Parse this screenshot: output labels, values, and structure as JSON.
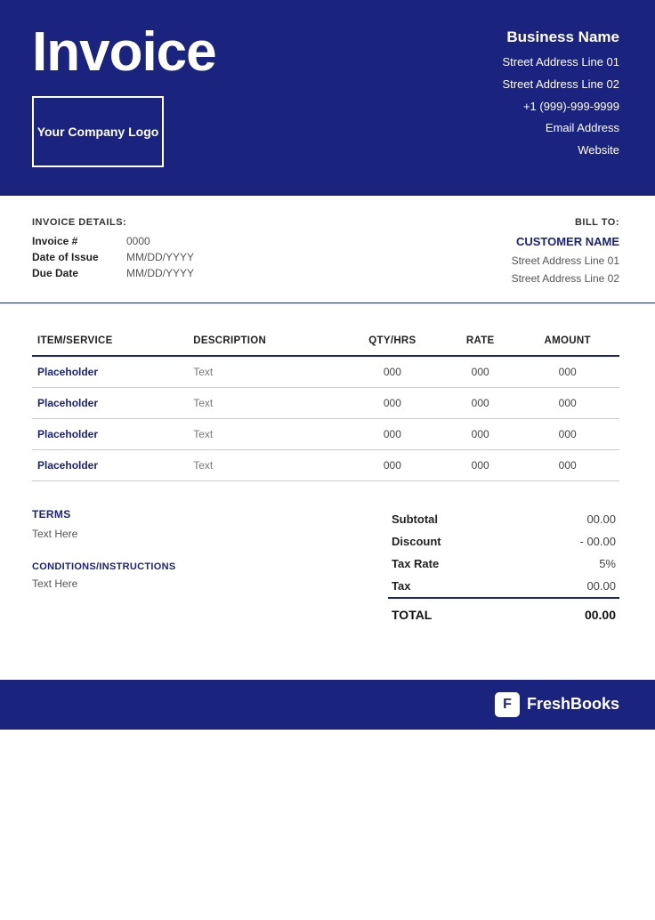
{
  "header": {
    "title": "Invoice",
    "logo_text": "Your Company Logo",
    "business": {
      "name": "Business Name",
      "address1": "Street Address Line 01",
      "address2": "Street Address Line 02",
      "phone": "+1 (999)-999-9999",
      "email": "Email Address",
      "website": "Website"
    }
  },
  "invoice_details": {
    "label": "INVOICE DETAILS:",
    "fields": [
      {
        "key": "Invoice #",
        "value": "0000"
      },
      {
        "key": "Date of Issue",
        "value": "MM/DD/YYYY"
      },
      {
        "key": "Due Date",
        "value": "MM/DD/YYYY"
      }
    ],
    "bill_to": {
      "label": "BILL TO:",
      "customer_name": "CUSTOMER NAME",
      "address1": "Street Address Line 01",
      "address2": "Street Address Line 02"
    }
  },
  "table": {
    "headers": [
      "ITEM/SERVICE",
      "DESCRIPTION",
      "QTY/HRS",
      "RATE",
      "AMOUNT"
    ],
    "rows": [
      {
        "name": "Placeholder",
        "description": "Text",
        "qty": "000",
        "rate": "000",
        "amount": "000"
      },
      {
        "name": "Placeholder",
        "description": "Text",
        "qty": "000",
        "rate": "000",
        "amount": "000"
      },
      {
        "name": "Placeholder",
        "description": "Text",
        "qty": "000",
        "rate": "000",
        "amount": "000"
      },
      {
        "name": "Placeholder",
        "description": "Text",
        "qty": "000",
        "rate": "000",
        "amount": "000"
      }
    ]
  },
  "terms": {
    "label": "TERMS",
    "text": "Text Here",
    "conditions_label": "CONDITIONS/INSTRUCTIONS",
    "conditions_text": "Text Here"
  },
  "totals": {
    "subtotal_label": "Subtotal",
    "subtotal_value": "00.00",
    "discount_label": "Discount",
    "discount_value": "- 00.00",
    "taxrate_label": "Tax Rate",
    "taxrate_value": "5%",
    "tax_label": "Tax",
    "tax_value": "00.00",
    "total_label": "TOTAL",
    "total_value": "00.00"
  },
  "footer": {
    "brand": "FreshBooks",
    "icon_letter": "F"
  }
}
